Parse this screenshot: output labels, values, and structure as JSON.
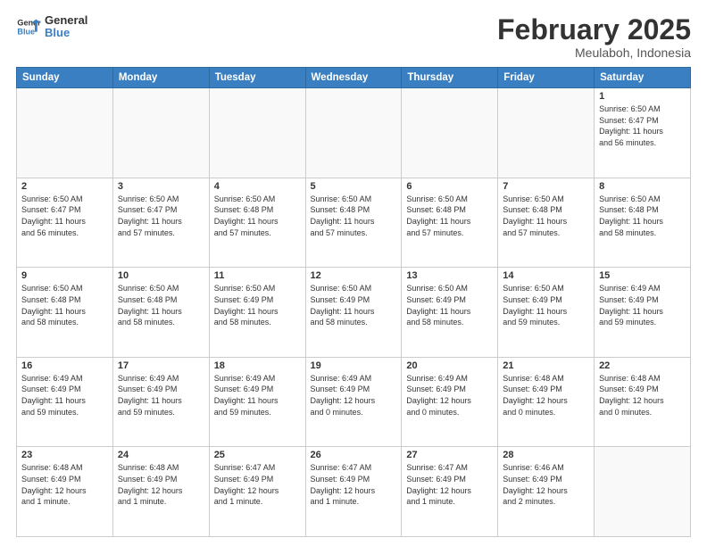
{
  "logo": {
    "line1": "General",
    "line2": "Blue"
  },
  "title": "February 2025",
  "subtitle": "Meulaboh, Indonesia",
  "days_of_week": [
    "Sunday",
    "Monday",
    "Tuesday",
    "Wednesday",
    "Thursday",
    "Friday",
    "Saturday"
  ],
  "weeks": [
    [
      {
        "day": "",
        "info": ""
      },
      {
        "day": "",
        "info": ""
      },
      {
        "day": "",
        "info": ""
      },
      {
        "day": "",
        "info": ""
      },
      {
        "day": "",
        "info": ""
      },
      {
        "day": "",
        "info": ""
      },
      {
        "day": "1",
        "info": "Sunrise: 6:50 AM\nSunset: 6:47 PM\nDaylight: 11 hours\nand 56 minutes."
      }
    ],
    [
      {
        "day": "2",
        "info": "Sunrise: 6:50 AM\nSunset: 6:47 PM\nDaylight: 11 hours\nand 56 minutes."
      },
      {
        "day": "3",
        "info": "Sunrise: 6:50 AM\nSunset: 6:47 PM\nDaylight: 11 hours\nand 57 minutes."
      },
      {
        "day": "4",
        "info": "Sunrise: 6:50 AM\nSunset: 6:48 PM\nDaylight: 11 hours\nand 57 minutes."
      },
      {
        "day": "5",
        "info": "Sunrise: 6:50 AM\nSunset: 6:48 PM\nDaylight: 11 hours\nand 57 minutes."
      },
      {
        "day": "6",
        "info": "Sunrise: 6:50 AM\nSunset: 6:48 PM\nDaylight: 11 hours\nand 57 minutes."
      },
      {
        "day": "7",
        "info": "Sunrise: 6:50 AM\nSunset: 6:48 PM\nDaylight: 11 hours\nand 57 minutes."
      },
      {
        "day": "8",
        "info": "Sunrise: 6:50 AM\nSunset: 6:48 PM\nDaylight: 11 hours\nand 58 minutes."
      }
    ],
    [
      {
        "day": "9",
        "info": "Sunrise: 6:50 AM\nSunset: 6:48 PM\nDaylight: 11 hours\nand 58 minutes."
      },
      {
        "day": "10",
        "info": "Sunrise: 6:50 AM\nSunset: 6:48 PM\nDaylight: 11 hours\nand 58 minutes."
      },
      {
        "day": "11",
        "info": "Sunrise: 6:50 AM\nSunset: 6:49 PM\nDaylight: 11 hours\nand 58 minutes."
      },
      {
        "day": "12",
        "info": "Sunrise: 6:50 AM\nSunset: 6:49 PM\nDaylight: 11 hours\nand 58 minutes."
      },
      {
        "day": "13",
        "info": "Sunrise: 6:50 AM\nSunset: 6:49 PM\nDaylight: 11 hours\nand 58 minutes."
      },
      {
        "day": "14",
        "info": "Sunrise: 6:50 AM\nSunset: 6:49 PM\nDaylight: 11 hours\nand 59 minutes."
      },
      {
        "day": "15",
        "info": "Sunrise: 6:49 AM\nSunset: 6:49 PM\nDaylight: 11 hours\nand 59 minutes."
      }
    ],
    [
      {
        "day": "16",
        "info": "Sunrise: 6:49 AM\nSunset: 6:49 PM\nDaylight: 11 hours\nand 59 minutes."
      },
      {
        "day": "17",
        "info": "Sunrise: 6:49 AM\nSunset: 6:49 PM\nDaylight: 11 hours\nand 59 minutes."
      },
      {
        "day": "18",
        "info": "Sunrise: 6:49 AM\nSunset: 6:49 PM\nDaylight: 11 hours\nand 59 minutes."
      },
      {
        "day": "19",
        "info": "Sunrise: 6:49 AM\nSunset: 6:49 PM\nDaylight: 12 hours\nand 0 minutes."
      },
      {
        "day": "20",
        "info": "Sunrise: 6:49 AM\nSunset: 6:49 PM\nDaylight: 12 hours\nand 0 minutes."
      },
      {
        "day": "21",
        "info": "Sunrise: 6:48 AM\nSunset: 6:49 PM\nDaylight: 12 hours\nand 0 minutes."
      },
      {
        "day": "22",
        "info": "Sunrise: 6:48 AM\nSunset: 6:49 PM\nDaylight: 12 hours\nand 0 minutes."
      }
    ],
    [
      {
        "day": "23",
        "info": "Sunrise: 6:48 AM\nSunset: 6:49 PM\nDaylight: 12 hours\nand 1 minute."
      },
      {
        "day": "24",
        "info": "Sunrise: 6:48 AM\nSunset: 6:49 PM\nDaylight: 12 hours\nand 1 minute."
      },
      {
        "day": "25",
        "info": "Sunrise: 6:47 AM\nSunset: 6:49 PM\nDaylight: 12 hours\nand 1 minute."
      },
      {
        "day": "26",
        "info": "Sunrise: 6:47 AM\nSunset: 6:49 PM\nDaylight: 12 hours\nand 1 minute."
      },
      {
        "day": "27",
        "info": "Sunrise: 6:47 AM\nSunset: 6:49 PM\nDaylight: 12 hours\nand 1 minute."
      },
      {
        "day": "28",
        "info": "Sunrise: 6:46 AM\nSunset: 6:49 PM\nDaylight: 12 hours\nand 2 minutes."
      },
      {
        "day": "",
        "info": ""
      }
    ]
  ]
}
